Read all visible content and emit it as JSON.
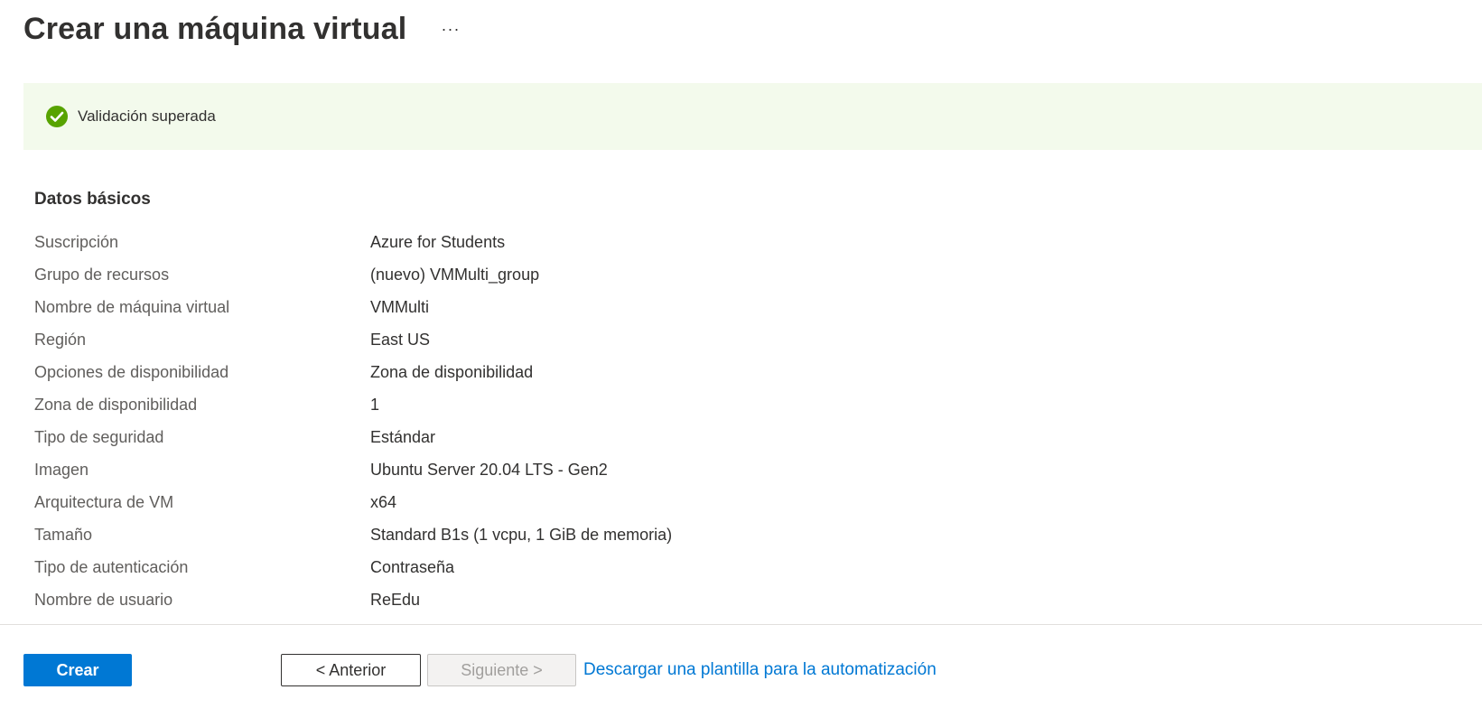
{
  "header": {
    "title": "Crear una máquina virtual",
    "more_label": "···"
  },
  "validation": {
    "icon": "check-circle-icon",
    "text": "Validación superada",
    "color": "#57a300"
  },
  "basics": {
    "title": "Datos básicos",
    "rows": [
      {
        "label": "Suscripción",
        "value": "Azure for Students"
      },
      {
        "label": "Grupo de recursos",
        "value": "(nuevo) VMMulti_group"
      },
      {
        "label": "Nombre de máquina virtual",
        "value": "VMMulti"
      },
      {
        "label": "Región",
        "value": "East US"
      },
      {
        "label": "Opciones de disponibilidad",
        "value": "Zona de disponibilidad"
      },
      {
        "label": "Zona de disponibilidad",
        "value": "1"
      },
      {
        "label": "Tipo de seguridad",
        "value": "Estándar"
      },
      {
        "label": "Imagen",
        "value": "Ubuntu Server 20.04 LTS - Gen2"
      },
      {
        "label": "Arquitectura de VM",
        "value": "x64"
      },
      {
        "label": "Tamaño",
        "value": "Standard B1s (1 vcpu, 1 GiB de memoria)"
      },
      {
        "label": "Tipo de autenticación",
        "value": "Contraseña"
      },
      {
        "label": "Nombre de usuario",
        "value": "ReEdu"
      }
    ]
  },
  "footer": {
    "create_label": "Crear",
    "previous_label": "< Anterior",
    "next_label": "Siguiente >",
    "download_link": "Descargar una plantilla para la automatización"
  },
  "colors": {
    "accent": "#0078d4",
    "banner_bg": "#f3faec"
  }
}
